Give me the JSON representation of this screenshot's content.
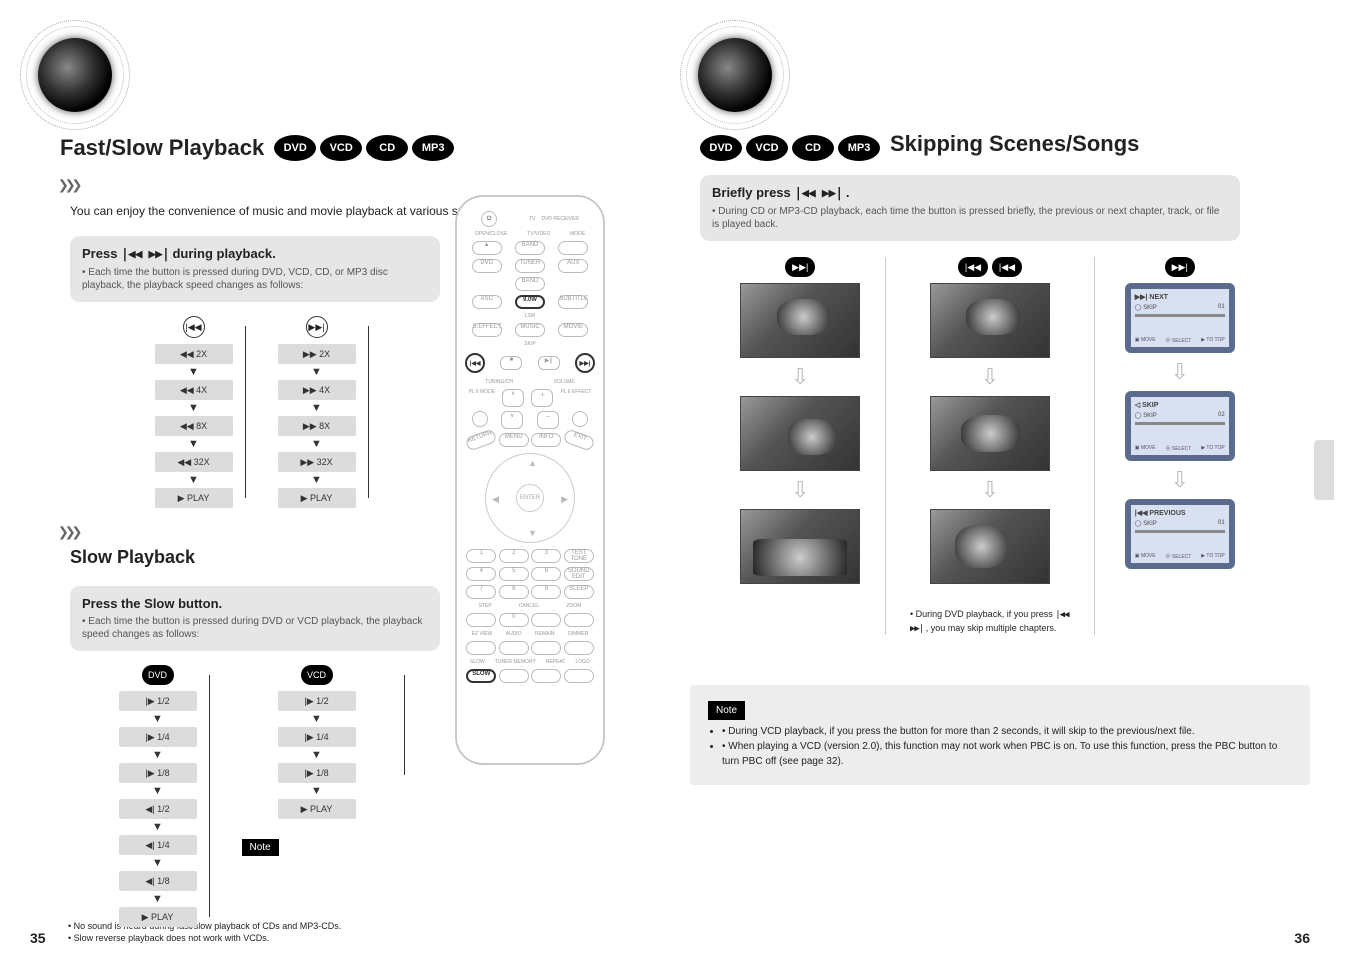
{
  "left": {
    "title": "Fast/Slow Playback",
    "badges": [
      "DVD",
      "VCD",
      "CD",
      "MP3"
    ],
    "subtitle": "You can enjoy the convenience of music and movie playback at various speeds.",
    "chevrons": "❯❯❯",
    "fast": {
      "heading_prefix": "Press",
      "heading_icons": "|◀◀ ▶▶|",
      "heading_suffix": "during playback.",
      "desc": "• Each time the button is pressed during DVD, VCD, CD, or MP3 disc playback, the playback speed changes as follows:",
      "left_btn": "|◀◀",
      "right_btn": "▶▶|",
      "left_states": [
        "◀◀ 2X",
        "◀◀ 4X",
        "◀◀ 8X",
        "◀◀ 32X",
        "▶ PLAY"
      ],
      "right_states": [
        "▶▶ 2X",
        "▶▶ 4X",
        "▶▶ 8X",
        "▶▶ 32X",
        "▶ PLAY"
      ]
    },
    "slow": {
      "heading": "Slow Playback",
      "step": "Press the Slow button.",
      "desc": "• Each time the button is pressed during DVD or VCD playback, the playback speed changes as follows:",
      "dvd_label": "DVD",
      "vcd_label": "VCD",
      "dvd_states": [
        "|▶ 1/2",
        "|▶ 1/4",
        "|▶ 1/8",
        "◀| 1/2",
        "◀| 1/4",
        "◀| 1/8",
        "▶ PLAY"
      ],
      "vcd_states": [
        "|▶ 1/2",
        "|▶ 1/4",
        "|▶ 1/8",
        "▶ PLAY"
      ]
    },
    "note": {
      "tag": "Note",
      "lines": [
        "• No sound is heard during fast/slow playback of CDs and MP3-CDs.",
        "• Slow reverse playback does not work with VCDs."
      ]
    },
    "page_num": "35"
  },
  "right": {
    "title": "Skipping Scenes/Songs",
    "badges": [
      "DVD",
      "VCD",
      "CD",
      "MP3"
    ],
    "heading_prefix": "Briefly press",
    "heading_icons": "|◀◀ ▶▶|",
    "heading_suffix": ".",
    "desc1": "• During CD or MP3-CD playback, each time the button is pressed briefly, the previous or next chapter, track, or file is played back.",
    "desc2_prefix": "• During DVD playback, if you press",
    "desc2_icons": "|◀◀ ▶▶|",
    "desc2_suffix": ", you may skip multiple chapters.",
    "cols": {
      "a_label": "▶▶|",
      "b_labels": [
        "|◀◀",
        "|◀◀"
      ],
      "c_label": "▶▶|"
    },
    "mp3": {
      "t1": "▶▶| NEXT",
      "t2": "◁ SKIP",
      "t3": "|◀◀ PREVIOUS",
      "foot": [
        "▣ MOVE",
        "⦿ SELECT",
        "▶ TO TOP"
      ]
    },
    "note": {
      "tag": "Note",
      "lines": [
        "• During VCD playback, if you press the button for more than 2 seconds, it will skip to the previous/next file.",
        "• When playing a VCD (version 2.0), this function may not work when PBC is on. To use this function, press the PBC button to turn PBC off (see page 32)."
      ]
    },
    "page_num": "36"
  },
  "remote": {
    "power": "⏻",
    "mode_row": [
      "TV",
      "DVD RECEIVER"
    ],
    "row1_labels": [
      "OPEN/CLOSE",
      "TV/VIDEO",
      "MODE"
    ],
    "row1": [
      "▲",
      "BAND",
      ""
    ],
    "src": [
      "DVD",
      "TUNER",
      "AUX"
    ],
    "src2": [
      "",
      "BAND",
      ""
    ],
    "src3": [
      "ASC",
      "9.0W",
      "SUBTITLE"
    ],
    "lsm": "LSM",
    "sound": [
      "S.EFFECT",
      "MUSIC",
      "MOVIE"
    ],
    "skip": "SKIP",
    "transport": [
      "|◀◀",
      "■",
      "▶||",
      "▶▶|"
    ],
    "tuning": "TUNING/CH",
    "volume": "VOLUME",
    "pl2": [
      "PL II MODE",
      "PL II EFFECT"
    ],
    "menu_row": [
      "MENU",
      "INFO"
    ],
    "side_row": [
      "RETURN",
      "EXIT"
    ],
    "enter": "ENTER",
    "numrow1": [
      "1",
      "2",
      "3"
    ],
    "numrow2": [
      "4",
      "5",
      "6"
    ],
    "numrow3": [
      "7",
      "8",
      "9"
    ],
    "numrow4_labels": [
      "STEP",
      "",
      "CANCEL",
      "ZOOM"
    ],
    "numrow4": [
      "",
      "0",
      "",
      ""
    ],
    "bottom_labels": [
      "EZ VIEW",
      "AUDIO",
      "REMAIN",
      ""
    ],
    "right_labels": [
      "TEST TONE",
      "SOUND EDIT",
      "SLEEP",
      "DIMMER"
    ],
    "last_row_labels": [
      "SLOW",
      "TUNER MEMORY",
      "REPEAT",
      "LOGO"
    ],
    "highlight1": "SLOW",
    "highlight2_left": "|◀◀",
    "highlight2_right": "▶▶|"
  }
}
